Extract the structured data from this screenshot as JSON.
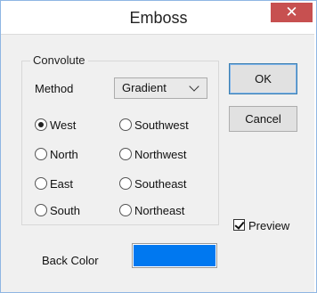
{
  "window": {
    "title": "Emboss",
    "close_glyph": "✕"
  },
  "group": {
    "title": "Convolute",
    "method_label": "Method",
    "method_value": "Gradient",
    "radios": [
      {
        "label": "West",
        "checked": true
      },
      {
        "label": "North",
        "checked": false
      },
      {
        "label": "East",
        "checked": false
      },
      {
        "label": "South",
        "checked": false
      },
      {
        "label": "Southwest",
        "checked": false
      },
      {
        "label": "Northwest",
        "checked": false
      },
      {
        "label": "Southeast",
        "checked": false
      },
      {
        "label": "Northeast",
        "checked": false
      }
    ]
  },
  "buttons": {
    "ok": "OK",
    "cancel": "Cancel"
  },
  "preview": {
    "label": "Preview",
    "checked": true
  },
  "back_color": {
    "label": "Back Color",
    "value": "#0078f0"
  },
  "colors": {
    "close_bg": "#c75050",
    "dialog_bg": "#f0f0f0"
  }
}
